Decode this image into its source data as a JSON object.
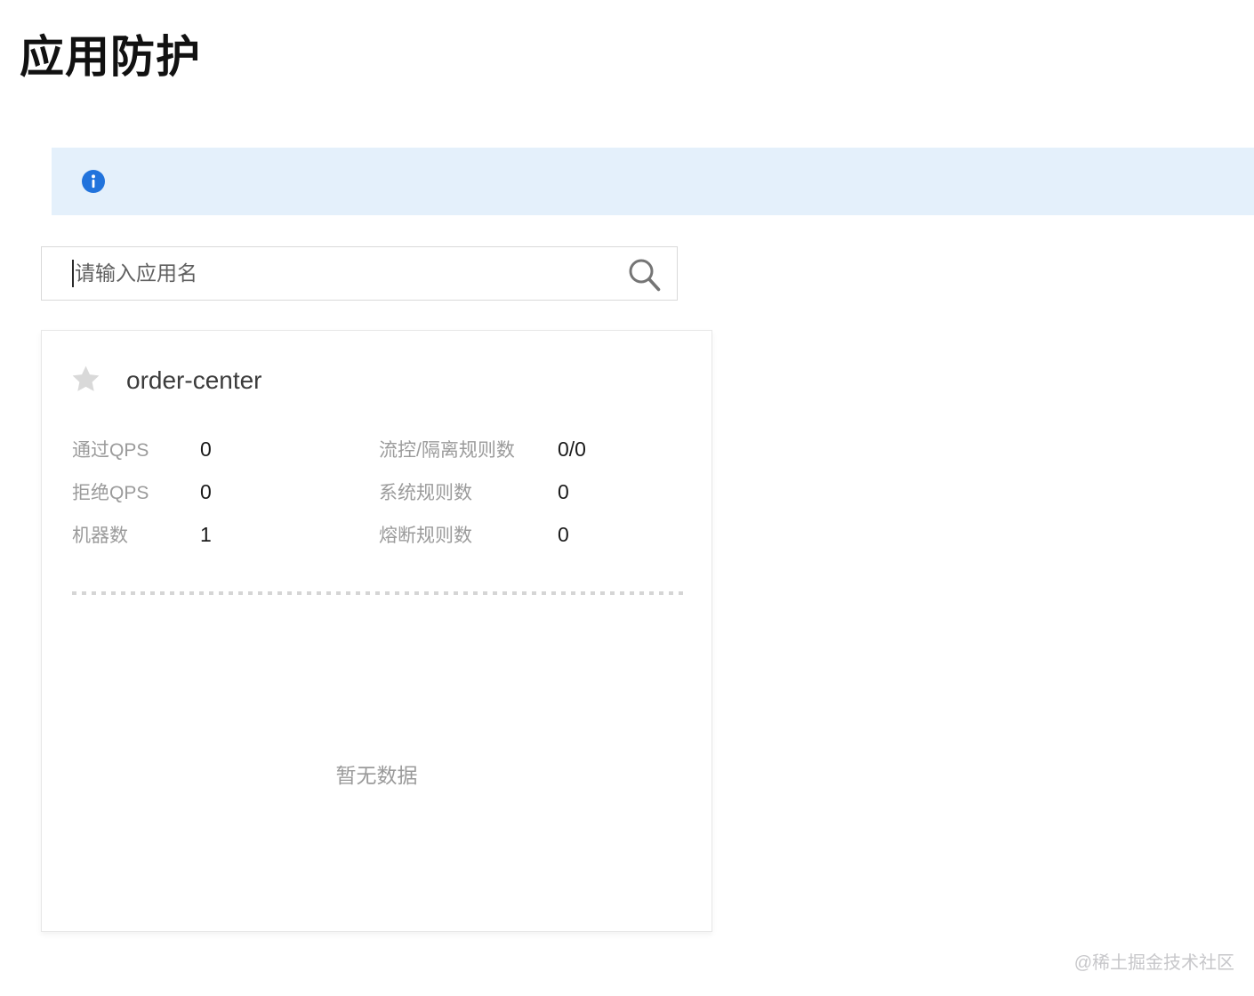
{
  "page": {
    "title": "应用防护",
    "watermark": "@稀土掘金技术社区"
  },
  "banner": {
    "icon": "info-icon",
    "bg_color": "#E4F0FB",
    "icon_color": "#2173DC"
  },
  "search": {
    "placeholder": "请输入应用名",
    "value": "",
    "icon": "search-icon"
  },
  "app_card": {
    "favorite_icon": "star-icon",
    "favorite_color": "#D9D9D9",
    "app_name": "order-center",
    "stats_left": [
      {
        "label": "通过QPS",
        "value": "0"
      },
      {
        "label": "拒绝QPS",
        "value": "0"
      },
      {
        "label": "机器数",
        "value": "1"
      }
    ],
    "stats_right": [
      {
        "label": "流控/隔离规则数",
        "value": "0/0"
      },
      {
        "label": "系统规则数",
        "value": "0"
      },
      {
        "label": "熔断规则数",
        "value": "0"
      }
    ],
    "empty_text": "暂无数据"
  }
}
